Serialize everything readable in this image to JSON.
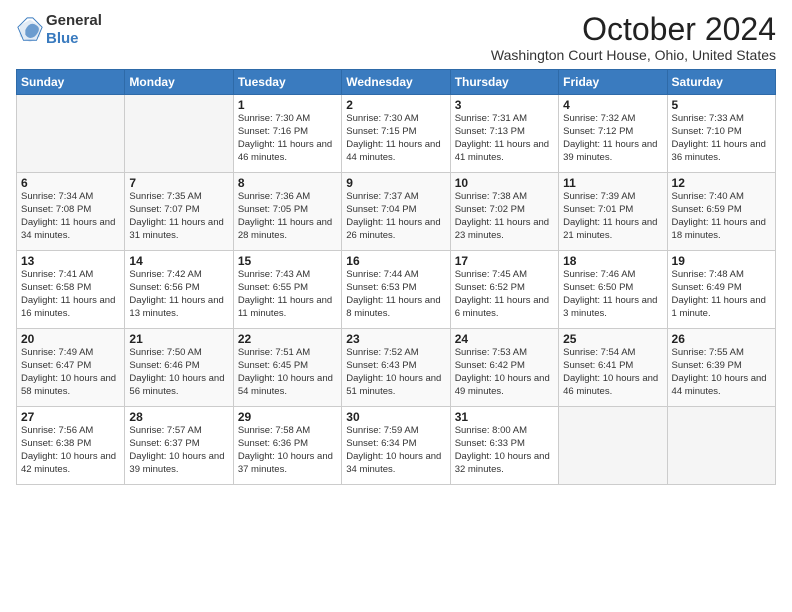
{
  "header": {
    "logo_line1": "General",
    "logo_line2": "Blue",
    "month_title": "October 2024",
    "location": "Washington Court House, Ohio, United States"
  },
  "days_of_week": [
    "Sunday",
    "Monday",
    "Tuesday",
    "Wednesday",
    "Thursday",
    "Friday",
    "Saturday"
  ],
  "weeks": [
    [
      {
        "num": "",
        "info": ""
      },
      {
        "num": "",
        "info": ""
      },
      {
        "num": "1",
        "info": "Sunrise: 7:30 AM\nSunset: 7:16 PM\nDaylight: 11 hours and 46 minutes."
      },
      {
        "num": "2",
        "info": "Sunrise: 7:30 AM\nSunset: 7:15 PM\nDaylight: 11 hours and 44 minutes."
      },
      {
        "num": "3",
        "info": "Sunrise: 7:31 AM\nSunset: 7:13 PM\nDaylight: 11 hours and 41 minutes."
      },
      {
        "num": "4",
        "info": "Sunrise: 7:32 AM\nSunset: 7:12 PM\nDaylight: 11 hours and 39 minutes."
      },
      {
        "num": "5",
        "info": "Sunrise: 7:33 AM\nSunset: 7:10 PM\nDaylight: 11 hours and 36 minutes."
      }
    ],
    [
      {
        "num": "6",
        "info": "Sunrise: 7:34 AM\nSunset: 7:08 PM\nDaylight: 11 hours and 34 minutes."
      },
      {
        "num": "7",
        "info": "Sunrise: 7:35 AM\nSunset: 7:07 PM\nDaylight: 11 hours and 31 minutes."
      },
      {
        "num": "8",
        "info": "Sunrise: 7:36 AM\nSunset: 7:05 PM\nDaylight: 11 hours and 28 minutes."
      },
      {
        "num": "9",
        "info": "Sunrise: 7:37 AM\nSunset: 7:04 PM\nDaylight: 11 hours and 26 minutes."
      },
      {
        "num": "10",
        "info": "Sunrise: 7:38 AM\nSunset: 7:02 PM\nDaylight: 11 hours and 23 minutes."
      },
      {
        "num": "11",
        "info": "Sunrise: 7:39 AM\nSunset: 7:01 PM\nDaylight: 11 hours and 21 minutes."
      },
      {
        "num": "12",
        "info": "Sunrise: 7:40 AM\nSunset: 6:59 PM\nDaylight: 11 hours and 18 minutes."
      }
    ],
    [
      {
        "num": "13",
        "info": "Sunrise: 7:41 AM\nSunset: 6:58 PM\nDaylight: 11 hours and 16 minutes."
      },
      {
        "num": "14",
        "info": "Sunrise: 7:42 AM\nSunset: 6:56 PM\nDaylight: 11 hours and 13 minutes."
      },
      {
        "num": "15",
        "info": "Sunrise: 7:43 AM\nSunset: 6:55 PM\nDaylight: 11 hours and 11 minutes."
      },
      {
        "num": "16",
        "info": "Sunrise: 7:44 AM\nSunset: 6:53 PM\nDaylight: 11 hours and 8 minutes."
      },
      {
        "num": "17",
        "info": "Sunrise: 7:45 AM\nSunset: 6:52 PM\nDaylight: 11 hours and 6 minutes."
      },
      {
        "num": "18",
        "info": "Sunrise: 7:46 AM\nSunset: 6:50 PM\nDaylight: 11 hours and 3 minutes."
      },
      {
        "num": "19",
        "info": "Sunrise: 7:48 AM\nSunset: 6:49 PM\nDaylight: 11 hours and 1 minute."
      }
    ],
    [
      {
        "num": "20",
        "info": "Sunrise: 7:49 AM\nSunset: 6:47 PM\nDaylight: 10 hours and 58 minutes."
      },
      {
        "num": "21",
        "info": "Sunrise: 7:50 AM\nSunset: 6:46 PM\nDaylight: 10 hours and 56 minutes."
      },
      {
        "num": "22",
        "info": "Sunrise: 7:51 AM\nSunset: 6:45 PM\nDaylight: 10 hours and 54 minutes."
      },
      {
        "num": "23",
        "info": "Sunrise: 7:52 AM\nSunset: 6:43 PM\nDaylight: 10 hours and 51 minutes."
      },
      {
        "num": "24",
        "info": "Sunrise: 7:53 AM\nSunset: 6:42 PM\nDaylight: 10 hours and 49 minutes."
      },
      {
        "num": "25",
        "info": "Sunrise: 7:54 AM\nSunset: 6:41 PM\nDaylight: 10 hours and 46 minutes."
      },
      {
        "num": "26",
        "info": "Sunrise: 7:55 AM\nSunset: 6:39 PM\nDaylight: 10 hours and 44 minutes."
      }
    ],
    [
      {
        "num": "27",
        "info": "Sunrise: 7:56 AM\nSunset: 6:38 PM\nDaylight: 10 hours and 42 minutes."
      },
      {
        "num": "28",
        "info": "Sunrise: 7:57 AM\nSunset: 6:37 PM\nDaylight: 10 hours and 39 minutes."
      },
      {
        "num": "29",
        "info": "Sunrise: 7:58 AM\nSunset: 6:36 PM\nDaylight: 10 hours and 37 minutes."
      },
      {
        "num": "30",
        "info": "Sunrise: 7:59 AM\nSunset: 6:34 PM\nDaylight: 10 hours and 34 minutes."
      },
      {
        "num": "31",
        "info": "Sunrise: 8:00 AM\nSunset: 6:33 PM\nDaylight: 10 hours and 32 minutes."
      },
      {
        "num": "",
        "info": ""
      },
      {
        "num": "",
        "info": ""
      }
    ]
  ]
}
